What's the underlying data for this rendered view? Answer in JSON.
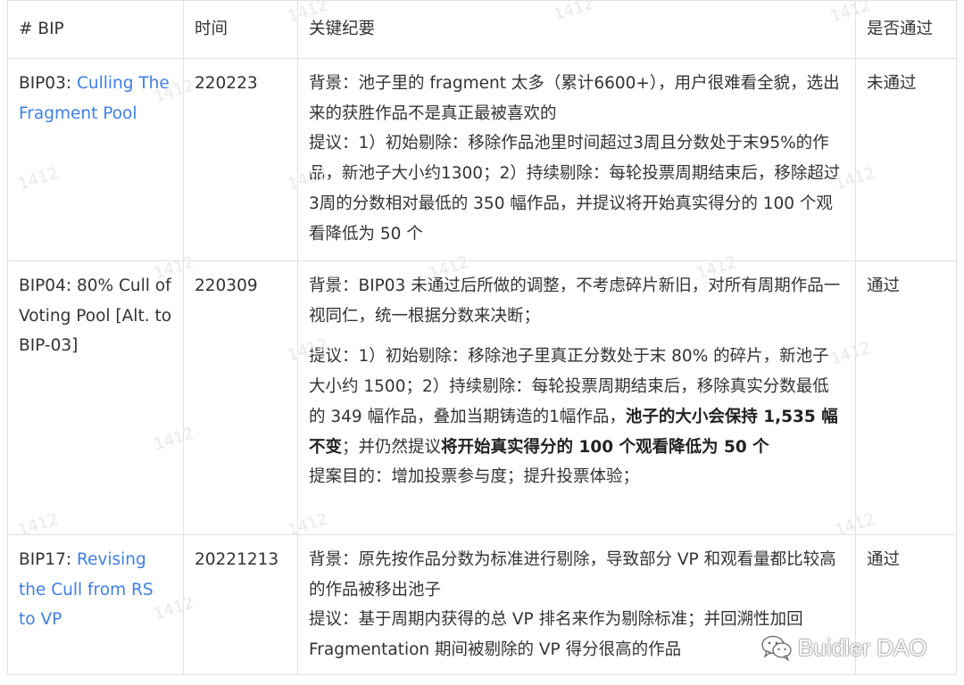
{
  "table": {
    "headers": {
      "bip": "# BIP",
      "time": "时间",
      "notes": "关键纪要",
      "passed": "是否通过"
    },
    "rows": [
      {
        "id": "BIP03: ",
        "title": "Culling The Fragment Pool",
        "date": "220223",
        "notes": {
          "background": "背景：池子里的 fragment 太多（累计6600+），用户很难看全貌，选出来的获胜作品不是真正最被喜欢的",
          "proposal": "提议：1）初始剔除：移除作品池里时间超过3周且分数处于末95%的作品，新池子大小约1300；2）持续剔除：每轮投票周期结束后，移除超过3周的分数相对最低的 350 幅作品，并提议将开始真实得分的 100 个观看降低为 50 个"
        },
        "status": "未通过"
      },
      {
        "id": "BIP04: 80% Cull of Voting Pool [Alt. to BIP-03]",
        "date": "220309",
        "notes": {
          "background": "背景：BIP03 未通过后所做的调整，不考虑碎片新旧，对所有周期作品一视同仁，统一根据分数来决断；",
          "proposal_a": "提议：1）初始剔除：移除池子里真正分数处于末 80% 的碎片，新池子大小约 1500；2）持续剔除：每轮投票周期结束后，移除真实分数最低的 349 幅作品，叠加当期铸造的1幅作品，",
          "proposal_b": "池子的大小会保持 1,535 幅不变",
          "proposal_c": "；并仍然提议",
          "proposal_d": "将开始真实得分的 100 个观看降低为 50 个",
          "purpose": "提案目的：增加投票参与度；提升投票体验；"
        },
        "status": "通过"
      },
      {
        "id": "BIP17: ",
        "title": "Revising the Cull from RS to VP",
        "date": "20221213",
        "notes": {
          "background": "背景：原先按作品分数为标准进行剔除，导致部分 VP 和观看量都比较高的作品被移出池子",
          "proposal": "提议：基于周期内获得的总 VP 排名来作为剔除标准；并回溯性加回Fragmentation 期间被剔除的 VP 得分很高的作品"
        },
        "status": "通过"
      }
    ]
  },
  "watermark": "1412",
  "brand": {
    "name": "Buidler DAO",
    "icon": "wechat-icon"
  },
  "colors": {
    "link": "#3f7fe6",
    "border": "#dfe2e5",
    "text": "#333333"
  }
}
